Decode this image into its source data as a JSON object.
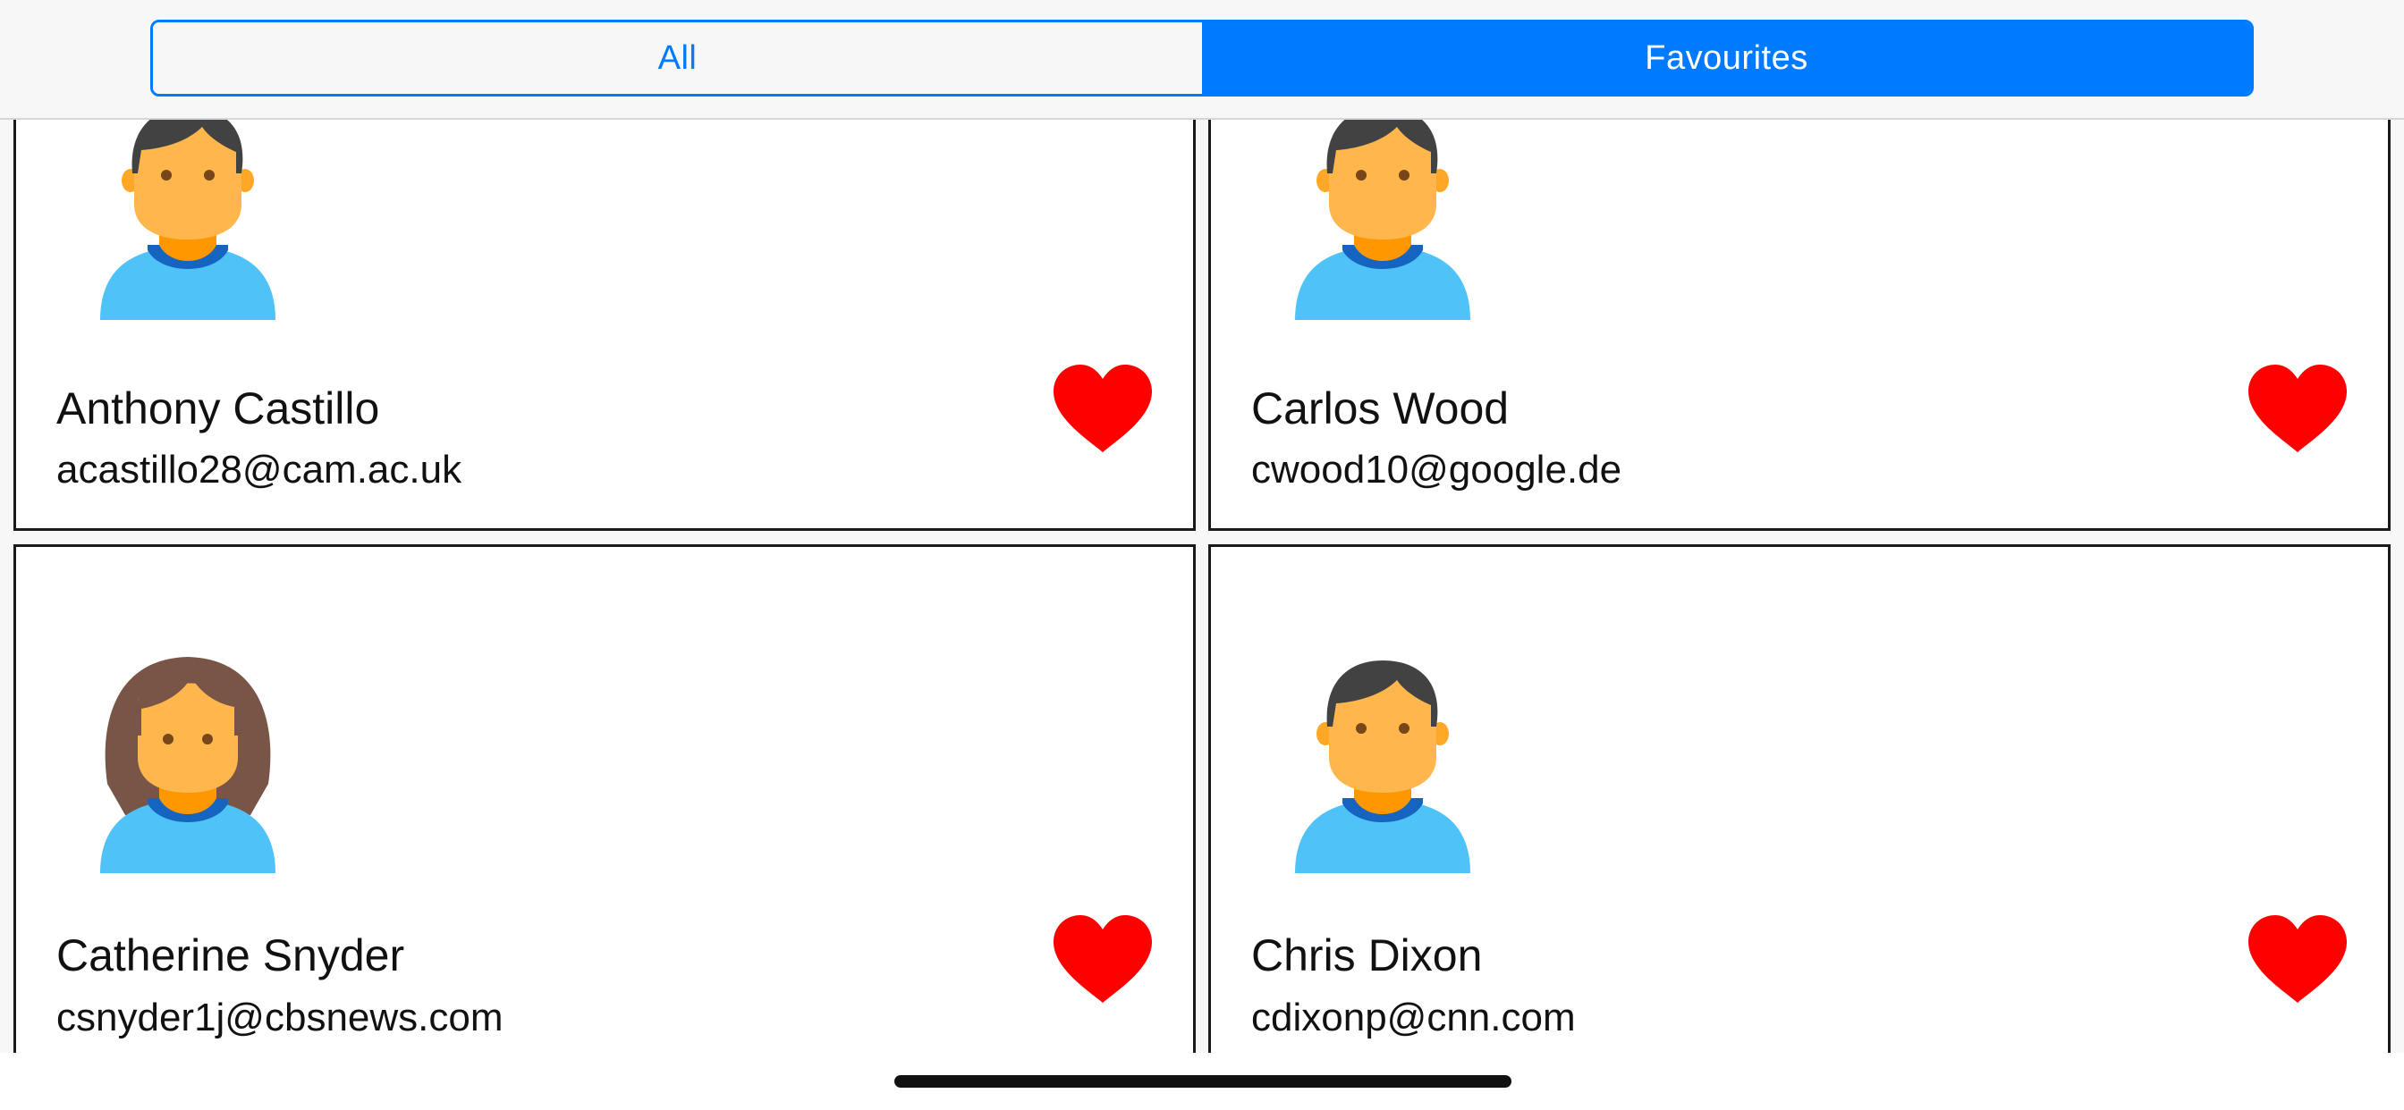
{
  "segments": {
    "all_label": "All",
    "favourites_label": "Favourites",
    "selected": "Favourites"
  },
  "colors": {
    "accent": "#007aff",
    "heart": "#ff0000",
    "card_border": "#1a1a1a"
  },
  "contacts": [
    {
      "name": "Anthony Castillo",
      "email": "acastillo28@cam.ac.uk",
      "avatar": "male-avatar-icon",
      "favourite": true
    },
    {
      "name": "Carlos Wood",
      "email": "cwood10@google.de",
      "avatar": "male-avatar-icon",
      "favourite": true
    },
    {
      "name": "Catherine Snyder",
      "email": "csnyder1j@cbsnews.com",
      "avatar": "female-avatar-icon",
      "favourite": true
    },
    {
      "name": "Chris Dixon",
      "email": "cdixonp@cnn.com",
      "avatar": "male-avatar-icon",
      "favourite": true
    }
  ]
}
